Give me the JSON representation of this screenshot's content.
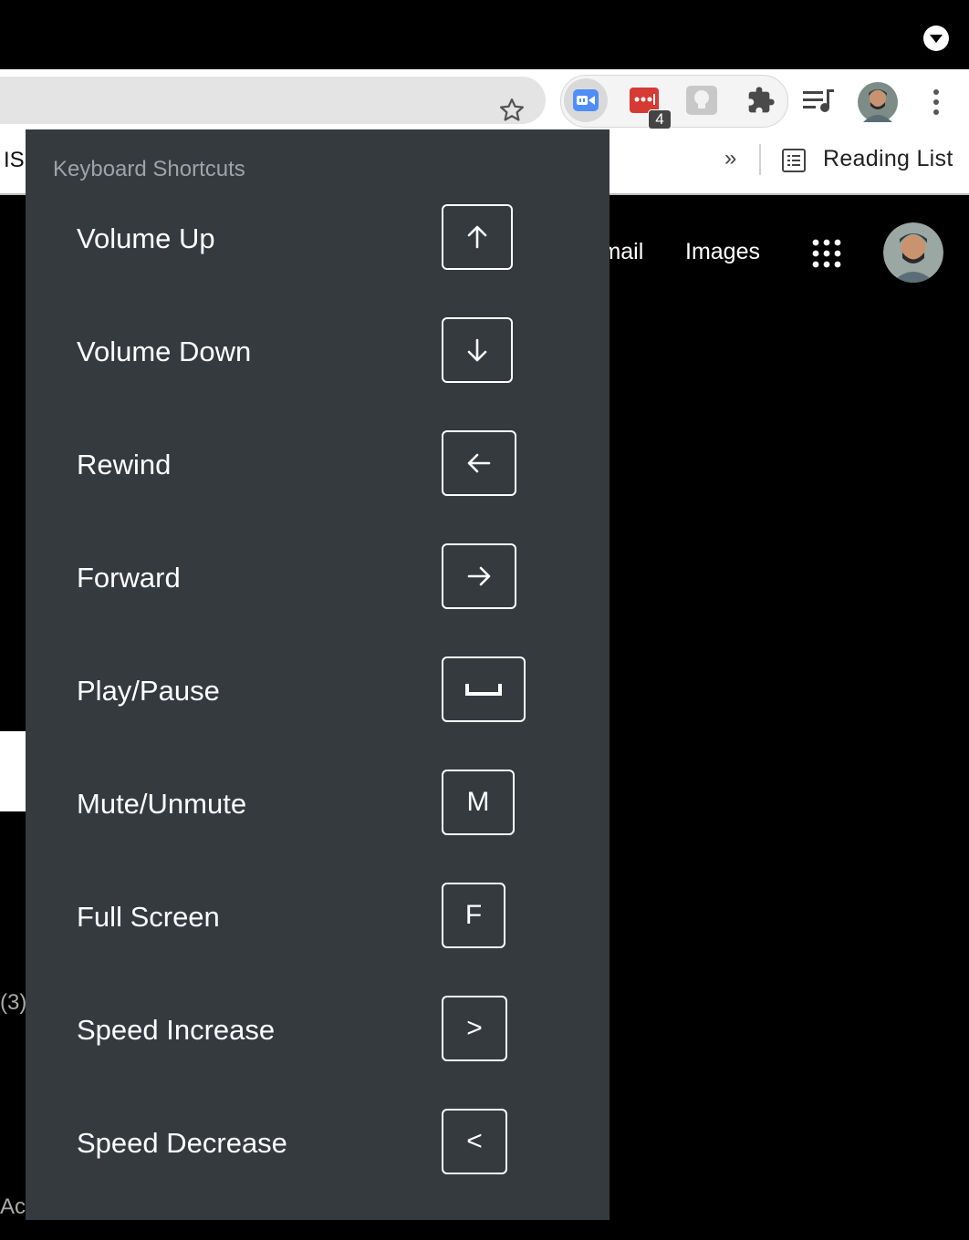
{
  "browser": {
    "bookmarks_left_text": "IS",
    "bookmarks_more": "»",
    "reading_list_label": "Reading List",
    "extension_badge": "4"
  },
  "page": {
    "gmail_link": "Gmail",
    "images_link": "Images",
    "side_text_1": "(3)",
    "side_text_2": "Ac"
  },
  "popup": {
    "title": "Keyboard Shortcuts",
    "shortcuts": [
      {
        "label": "Volume Up",
        "key": "↑",
        "icon": "arrow-up-icon"
      },
      {
        "label": "Volume Down",
        "key": "↓",
        "icon": "arrow-down-icon"
      },
      {
        "label": "Rewind",
        "key": "←",
        "icon": "arrow-left-icon"
      },
      {
        "label": "Forward",
        "key": "→",
        "icon": "arrow-right-icon"
      },
      {
        "label": "Play/Pause",
        "key": "␣",
        "icon": "space-bar-icon"
      },
      {
        "label": "Mute/Unmute",
        "key": "M"
      },
      {
        "label": "Full Screen",
        "key": "F"
      },
      {
        "label": "Speed Increase",
        "key": ">"
      },
      {
        "label": "Speed Decrease",
        "key": "<"
      }
    ]
  },
  "colors": {
    "popup_bg": "#353a3f",
    "page_bg": "#000000",
    "ext_blue": "#4f8ef7",
    "ext_red": "#d63a33"
  }
}
